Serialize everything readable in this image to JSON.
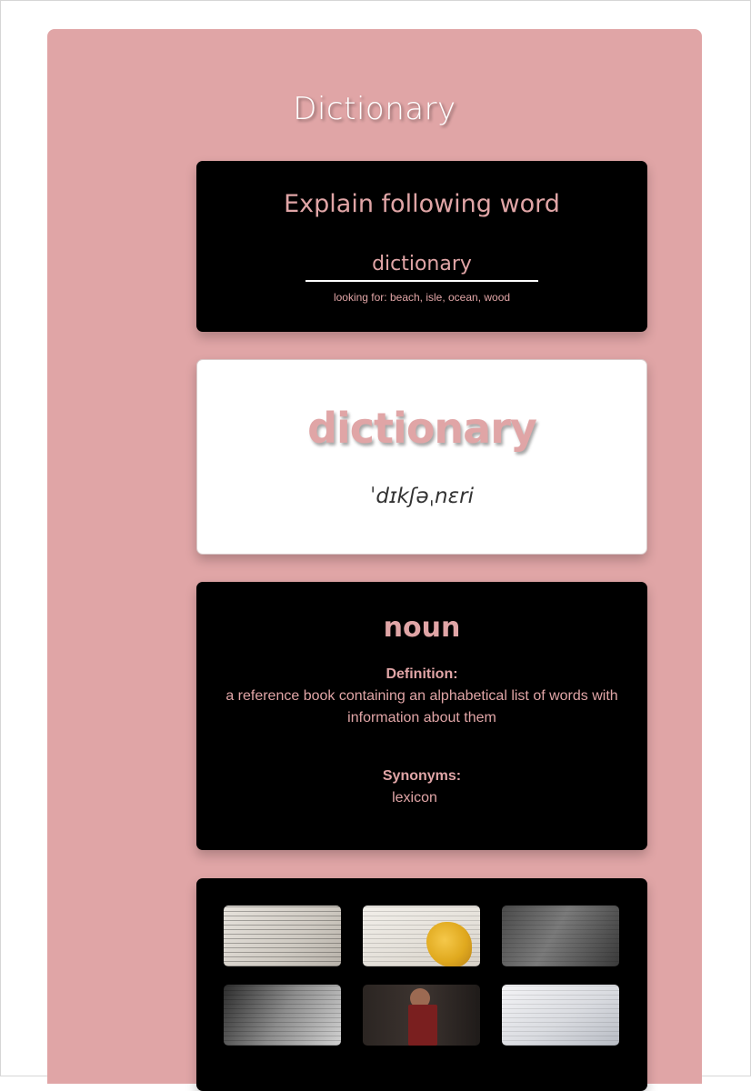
{
  "app": {
    "title": "Dictionary",
    "accent_color": "#e0a5a6"
  },
  "search": {
    "heading": "Explain following word",
    "input_value": "dictionary",
    "hint": "looking for: beach, isle, ocean, wood"
  },
  "word": {
    "text": "dictionary",
    "phonetic": "ˈdɪkʃəˌnɛri"
  },
  "meaning": {
    "part_of_speech": "noun",
    "definition_label": "Definition:",
    "definition": "a reference book containing an alphabetical list of words with information about them",
    "synonyms_label": "Synonyms:",
    "synonyms": "lexicon"
  },
  "gallery": {
    "images": [
      {
        "icon": "dictionary-page-photo"
      },
      {
        "icon": "dictionary-tassel-photo"
      },
      {
        "icon": "open-book-photo"
      },
      {
        "icon": "dictionary-closeup-photo"
      },
      {
        "icon": "person-holding-book-photo"
      },
      {
        "icon": "open-dictionary-photo"
      }
    ]
  }
}
